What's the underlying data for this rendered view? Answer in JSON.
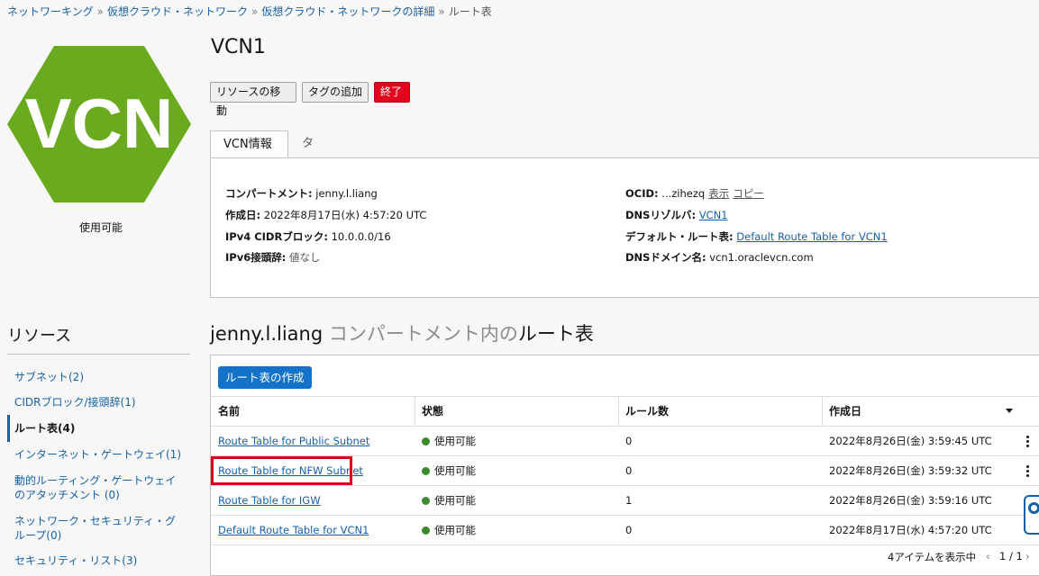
{
  "breadcrumb": {
    "items": [
      "ネットワーキング",
      "仮想クラウド・ネットワーク",
      "仮想クラウド・ネットワークの詳細"
    ],
    "current": "ルート表",
    "separator": "»"
  },
  "resource_icon": {
    "text": "VCN",
    "color": "#6aaa1e",
    "icon": "hexagon-icon",
    "status": "使用可能"
  },
  "page_title": "VCN1",
  "actions": {
    "move": "リソースの移動",
    "add_tag": "タグの追加",
    "terminate": "終了"
  },
  "info_tabs": [
    "VCN情報",
    "タグ"
  ],
  "info": {
    "compartment_label": "コンパートメント:",
    "compartment": "jenny.l.liang",
    "created_label": "作成日:",
    "created": "2022年8月17日(水) 4:57:20 UTC",
    "ipv4_label": "IPv4 CIDRブロック:",
    "ipv4": "10.0.0.0/16",
    "ipv6_label": "IPv6接頭辞:",
    "ipv6": "値なし",
    "ocid_label": "OCID:",
    "ocid": "...zihezq",
    "ocid_show": "表示",
    "ocid_copy": "コピー",
    "dns_resolver_label": "DNSリゾルバ:",
    "dns_resolver": "VCN1",
    "default_rt_label": "デフォルト・ルート表:",
    "default_rt": "Default Route Table for VCN1",
    "dns_domain_label": "DNSドメイン名:",
    "dns_domain": "vcn1.oraclevcn.com"
  },
  "resources": {
    "heading": "リソース",
    "items": [
      "サブネット(2)",
      "CIDRブロック/接頭辞(1)",
      "ルート表(4)",
      "インターネット・ゲートウェイ(1)",
      "動的ルーティング・ゲートウェイ",
      "のアタッチメント (0)",
      "ネットワーク・セキュリティ・グ",
      "ループ(0)",
      "セキュリティ・リスト(3)"
    ]
  },
  "section": {
    "compartment": "jenny.l.liang",
    "middle": "コンパートメント内の",
    "name": "ルート表"
  },
  "table": {
    "create_button": "ルート表の作成",
    "columns": [
      "名前",
      "状態",
      "ルール数",
      "作成日"
    ],
    "rows": [
      {
        "name": "Route Table for Public Subnet",
        "state": "使用可能",
        "rules": "0",
        "created": "2022年8月26日(金) 3:59:45 UTC"
      },
      {
        "name": "Route Table for NFW Subnet",
        "state": "使用可能",
        "rules": "0",
        "created": "2022年8月26日(金) 3:59:32 UTC"
      },
      {
        "name": "Route Table for IGW",
        "state": "使用可能",
        "rules": "1",
        "created": "2022年8月26日(金) 3:59:16 UTC"
      },
      {
        "name": "Default Route Table for VCN1",
        "state": "使用可能",
        "rules": "0",
        "created": "2022年8月17日(水) 4:57:20 UTC"
      }
    ],
    "status_color": "#3c8a2e",
    "highlight_color": "#d8001e",
    "pager_text": "4アイテムを表示中",
    "page": "1 / 1"
  }
}
